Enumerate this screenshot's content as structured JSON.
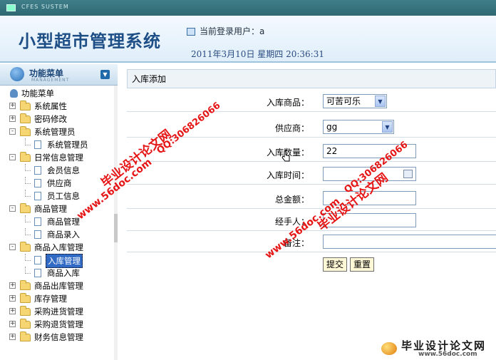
{
  "window": {
    "system_label": "CFES SUSTEM"
  },
  "header": {
    "app_title": "小型超市管理系统",
    "current_user_label": "当前登录用户：a",
    "datetime": "2011年3月10日  星期四  20:36:31"
  },
  "sidebar": {
    "menu_title": "功能菜单",
    "menu_subtitle": "MANAGEMENT",
    "root_label": "功能菜单",
    "items": [
      {
        "type": "folder",
        "label": "系统属性",
        "toggle": "+"
      },
      {
        "type": "folder",
        "label": "密码修改",
        "toggle": "+"
      },
      {
        "type": "folder",
        "label": "系统管理员",
        "toggle": "-"
      },
      {
        "type": "leaf",
        "label": "系统管理员"
      },
      {
        "type": "folder",
        "label": "日常信息管理",
        "toggle": "-"
      },
      {
        "type": "leaf",
        "label": "会员信息"
      },
      {
        "type": "leaf",
        "label": "供应商"
      },
      {
        "type": "leaf",
        "label": "员工信息"
      },
      {
        "type": "folder",
        "label": "商品管理",
        "toggle": "-"
      },
      {
        "type": "leaf",
        "label": "商品管理"
      },
      {
        "type": "leaf",
        "label": "商品录入"
      },
      {
        "type": "folder",
        "label": "商品入库管理",
        "toggle": "-"
      },
      {
        "type": "leaf",
        "label": "入库管理",
        "active": true
      },
      {
        "type": "leaf",
        "label": "商品入库"
      },
      {
        "type": "folder",
        "label": "商品出库管理",
        "toggle": "+"
      },
      {
        "type": "folder",
        "label": "库存管理",
        "toggle": "+"
      },
      {
        "type": "folder",
        "label": "采购进货管理",
        "toggle": "+"
      },
      {
        "type": "folder",
        "label": "采购退货管理",
        "toggle": "+"
      },
      {
        "type": "folder",
        "label": "财务信息管理",
        "toggle": "+"
      }
    ]
  },
  "form": {
    "title": "入库添加",
    "product_label": "入库商品：",
    "product_value": "可苦可乐",
    "supplier_label": "供应商：",
    "supplier_value": "gg",
    "quantity_label": "入库数量：",
    "quantity_value": "22",
    "time_label": "入库时间：",
    "time_value": "",
    "total_label": "总金额：",
    "total_value": "",
    "handler_label": "经手人：",
    "handler_value": "",
    "notes_label": "备注：",
    "notes_value": "",
    "submit_label": "提交",
    "reset_label": "重置"
  },
  "watermarks": {
    "text_site": "www.56doc.com",
    "text_qq": "QQ:306826066",
    "text_brand": "毕业设计论文网"
  },
  "brand": {
    "name": "毕业设计论文网",
    "url": "www.56doc.com"
  },
  "colors": {
    "accent": "#1d4f86",
    "header_bg": "#dfeef9",
    "watermark": "#e61515",
    "active_item": "#316ac5"
  }
}
